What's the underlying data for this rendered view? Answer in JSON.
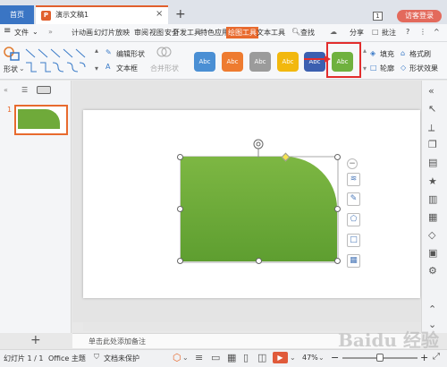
{
  "titlebar": {
    "home_tab": "首页",
    "doc_logo": "P",
    "doc_tab": "演示文稿1",
    "close_glyph": "×",
    "add_tab": "+",
    "window_count": "1",
    "visitor_login": "访客登录"
  },
  "menu": {
    "hamburger": "≡",
    "file": "文件",
    "file_arrow": "⌄",
    "more": "»",
    "items": [
      "计",
      "动画",
      "幻灯片放映",
      "审阅",
      "视图",
      "安全",
      "开发工具",
      "特色应用",
      "绘图工具",
      "文本工具"
    ],
    "search": "查找",
    "cloud": "☁",
    "share": "分享",
    "comment": "批注",
    "help": "?",
    "more_dots": "⋮",
    "collapse": "^"
  },
  "ribbon": {
    "shape_label": "形状",
    "edit_shape": "编辑形状",
    "text_box": "文本框",
    "merge_shape": "合并形状",
    "style_labels": [
      "Abc",
      "Abc",
      "Abc",
      "Abc",
      "Abc",
      "Abc"
    ],
    "fill": "填充",
    "outline": "轮廓",
    "format_painter": "格式刷",
    "shape_effects": "形状效果"
  },
  "colors": {
    "style_blue": "#4a8fd4",
    "style_orange": "#ee7b30",
    "style_gray": "#9b9b9b",
    "style_yellow": "#f2b80e",
    "style_darkblue": "#3b5fb0",
    "style_green": "#6fb13e",
    "highlight": "#e22d2d",
    "accent": "#e86a2e"
  },
  "left_panel": {
    "collapse_arrow": "«",
    "slide_number": "1",
    "add_slide": "+"
  },
  "notes": {
    "placeholder": "单击此处添加备注"
  },
  "status": {
    "slide_info": "幻灯片 1 / 1",
    "theme": "Office 主题",
    "protection": "文档未保护",
    "zoom": "47%",
    "zoom_minus": "−",
    "zoom_plus": "+",
    "play": "▶"
  },
  "watermark": "Baidu 经验"
}
